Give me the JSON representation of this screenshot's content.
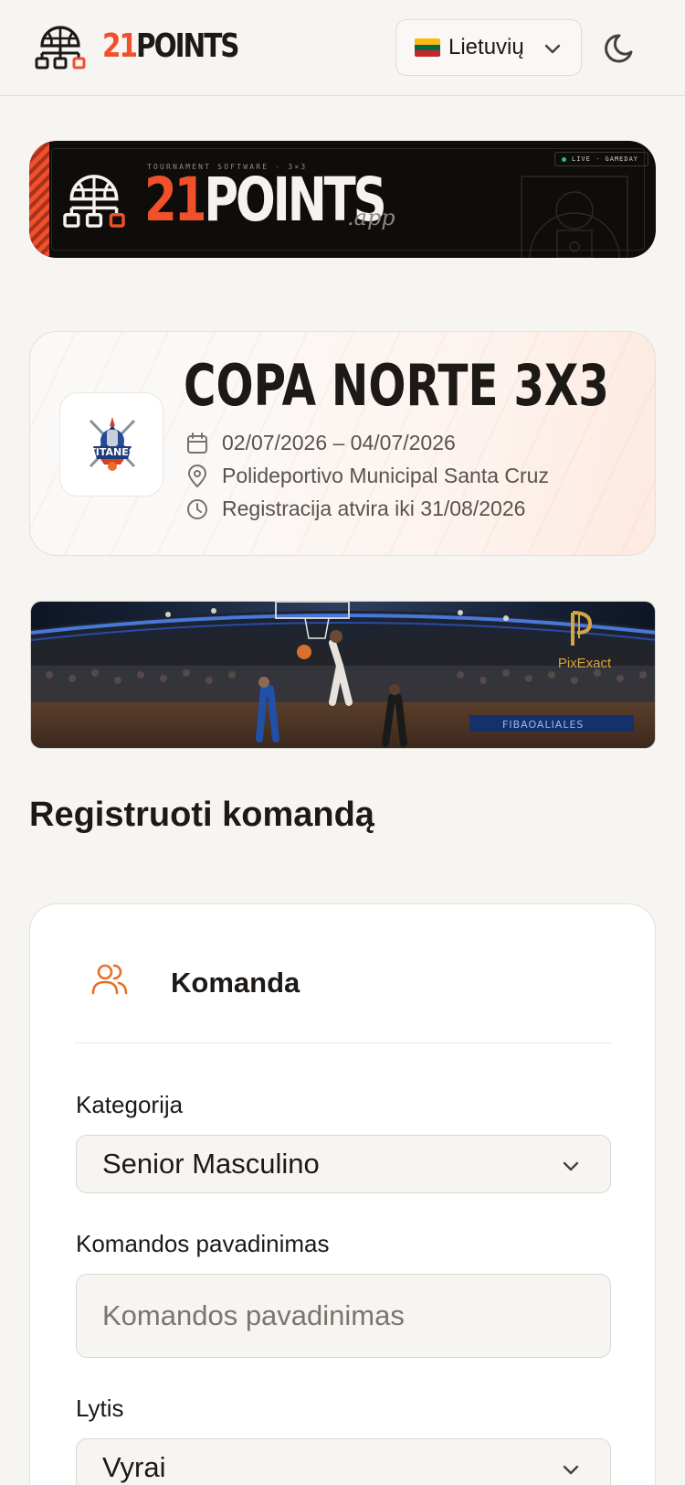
{
  "header": {
    "logo_num": "21",
    "logo_word": "POINTS",
    "language": {
      "label": "Lietuvių",
      "flag_colors": [
        "#fdb913",
        "#006a44",
        "#c1272d"
      ]
    },
    "theme_icon": "moon-icon"
  },
  "banner": {
    "tagline": "TOURNAMENT SOFTWARE · 3×3",
    "live_label": "LIVE · GAMEDAY",
    "logo_num": "21",
    "logo_word": "POINTS",
    "suffix": ".app"
  },
  "event": {
    "title": "COPA NORTE 3X3",
    "logo_text": "TITANES",
    "dates": "02/07/2026 – 04/07/2026",
    "venue": "Polideportivo Municipal Santa Cruz",
    "registration": "Registracija atvira iki 31/08/2026"
  },
  "sponsor_banner": {
    "sponsor": "PixExact",
    "scoreboard_text": "FIBAOALIALES"
  },
  "section_title": "Registruoti komandą",
  "form": {
    "section_label": "Komanda",
    "category": {
      "label": "Kategorija",
      "value": "Senior Masculino"
    },
    "team_name": {
      "label": "Komandos pavadinimas",
      "placeholder": "Komandos pavadinimas",
      "value": ""
    },
    "gender": {
      "label": "Lytis",
      "value": "Vyrai"
    }
  },
  "colors": {
    "accent": "#f0502a",
    "background": "#f7f5f2",
    "text": "#1c1917",
    "muted": "#57534e"
  }
}
